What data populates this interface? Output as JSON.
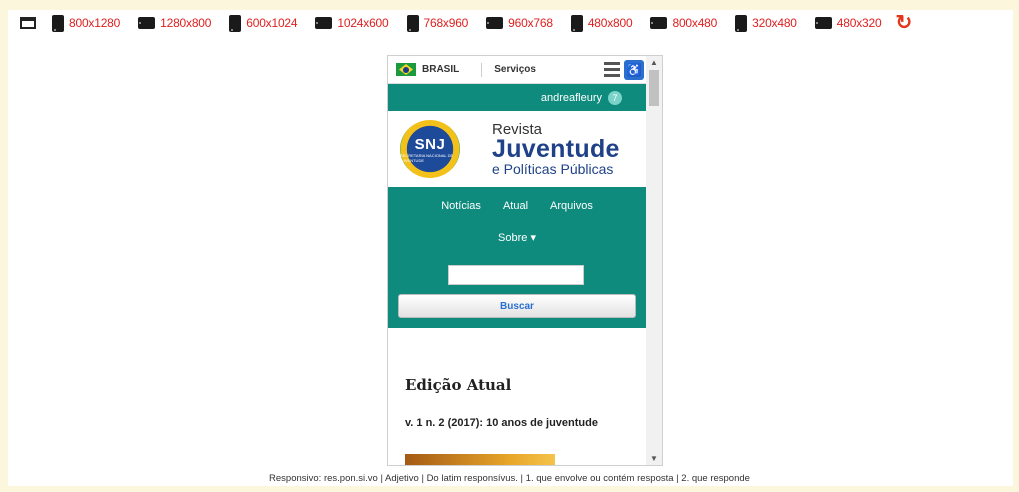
{
  "toolbar": {
    "sizes": [
      {
        "label": "800x1280",
        "orientation": "portrait"
      },
      {
        "label": "1280x800",
        "orientation": "landscape"
      },
      {
        "label": "600x1024",
        "orientation": "portrait"
      },
      {
        "label": "1024x600",
        "orientation": "landscape"
      },
      {
        "label": "768x960",
        "orientation": "portrait"
      },
      {
        "label": "960x768",
        "orientation": "landscape"
      },
      {
        "label": "480x800",
        "orientation": "portrait"
      },
      {
        "label": "800x480",
        "orientation": "landscape"
      },
      {
        "label": "320x480",
        "orientation": "portrait"
      },
      {
        "label": "480x320",
        "orientation": "landscape"
      }
    ],
    "reload_icon": "reload-icon",
    "label_color": "#e02020"
  },
  "site": {
    "gov": {
      "country": "BRASIL",
      "services": "Serviços"
    },
    "user": {
      "name": "andreafleury",
      "count": "7"
    },
    "logo": {
      "emblem": "SNJ",
      "emblem_sub": "SECRETARIA NACIONAL DE JUVENTUDE",
      "revista": "Revista",
      "juventude": "Juventude",
      "subtitle": "e Políticas Públicas"
    },
    "nav": {
      "noticias": "Notícias",
      "atual": "Atual",
      "arquivos": "Arquivos",
      "sobre": "Sobre ▾"
    },
    "search": {
      "value": "",
      "button": "Buscar"
    },
    "edition": {
      "title": "Edição Atual",
      "issue": "v. 1 n. 2 (2017): 10 anos de juventude"
    },
    "accent": "#0f8b7d"
  },
  "footer": "Responsivo: res.pon.si.vo | Adjetivo | Do latim responsívus. | 1. que envolve ou contém resposta | 2. que responde"
}
